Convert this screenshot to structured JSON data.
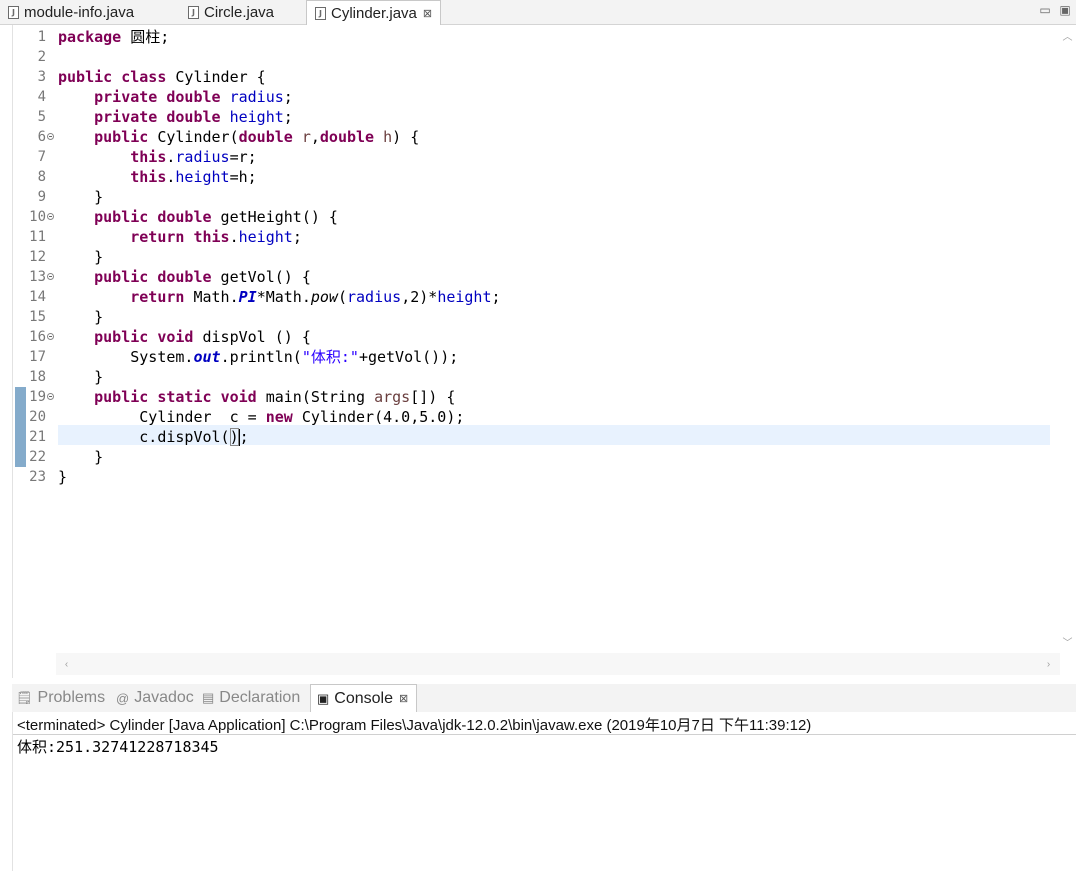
{
  "editor_tabs": [
    {
      "label": "module-info.java",
      "icon": "java-file-icon"
    },
    {
      "label": "Circle.java",
      "icon": "java-file-icon"
    },
    {
      "label": "Cylinder.java",
      "icon": "java-file-icon",
      "active": true,
      "close": "⊠"
    }
  ],
  "window_controls": {
    "minimize": "▭",
    "maximize": "▣"
  },
  "editor": {
    "lines": [
      {
        "n": "1"
      },
      {
        "n": "2"
      },
      {
        "n": "3"
      },
      {
        "n": "4"
      },
      {
        "n": "5"
      },
      {
        "n": "6",
        "fold": true
      },
      {
        "n": "7"
      },
      {
        "n": "8"
      },
      {
        "n": "9"
      },
      {
        "n": "10",
        "fold": true
      },
      {
        "n": "11"
      },
      {
        "n": "12"
      },
      {
        "n": "13",
        "fold": true
      },
      {
        "n": "14"
      },
      {
        "n": "15"
      },
      {
        "n": "16",
        "fold": true
      },
      {
        "n": "17"
      },
      {
        "n": "18"
      },
      {
        "n": "19",
        "fold": true
      },
      {
        "n": "20"
      },
      {
        "n": "21"
      },
      {
        "n": "22"
      },
      {
        "n": "23"
      }
    ],
    "code": {
      "package": "package",
      "package_name": " 圆柱;",
      "public": "public",
      "private": "private",
      "class": "class",
      "double": "double",
      "this": "this",
      "return": "return",
      "void": "void",
      "static": "static",
      "new": "new",
      "class_name": " Cylinder {",
      "radius": "radius",
      "height": "height",
      "r": "r",
      "h": "h",
      "args": "args",
      "semicolon": ";",
      "ctor_open": " Cylinder(",
      "comma": ",",
      "paren_brace": ") {",
      "dot": ".",
      "assign_r": "=r;",
      "assign_h": "=h;",
      "close_brace": "}",
      "getHeight_sig": " getHeight() {",
      "getVol_sig": " getVol() {",
      "math1": " Math.",
      "PI": "PI",
      "math2": "*Math.",
      "pow": "pow",
      "pow_open": "(",
      "pow_rest": ",2)*",
      "dispVol_sig": " dispVol () {",
      "system": "System.",
      "out": "out",
      "println_open": ".println(",
      "str_vol": "\"体积:\"",
      "println_rest": "+getVol());",
      "main_sig": " main(String ",
      "main_rest": "[]) {",
      "cyl_decl": "Cylinder  c = ",
      "new_call": " Cylinder(4.0,5.0);",
      "disp_call": "c.dispVol(",
      "close_paren": ")",
      "end_semicolon": ";",
      "indent4": "    ",
      "indent5": "     ",
      "indent8": "        "
    }
  },
  "console_tabs": [
    {
      "label": "Problems",
      "icon": "problems-icon"
    },
    {
      "label": "Javadoc",
      "icon": "javadoc-icon"
    },
    {
      "label": "Declaration",
      "icon": "declaration-icon"
    },
    {
      "label": "Console",
      "icon": "console-icon",
      "active": true,
      "close": "⊠"
    }
  ],
  "console": {
    "header": "<terminated> Cylinder [Java Application] C:\\Program Files\\Java\\jdk-12.0.2\\bin\\javaw.exe (2019年10月7日 下午11:39:12)",
    "output": "体积:251.32741228718345"
  },
  "colors": {
    "keyword": "#7f0055",
    "field": "#0000c0",
    "string": "#2a00ff",
    "current_line": "#e8f2fe",
    "line_number": "#787878"
  }
}
